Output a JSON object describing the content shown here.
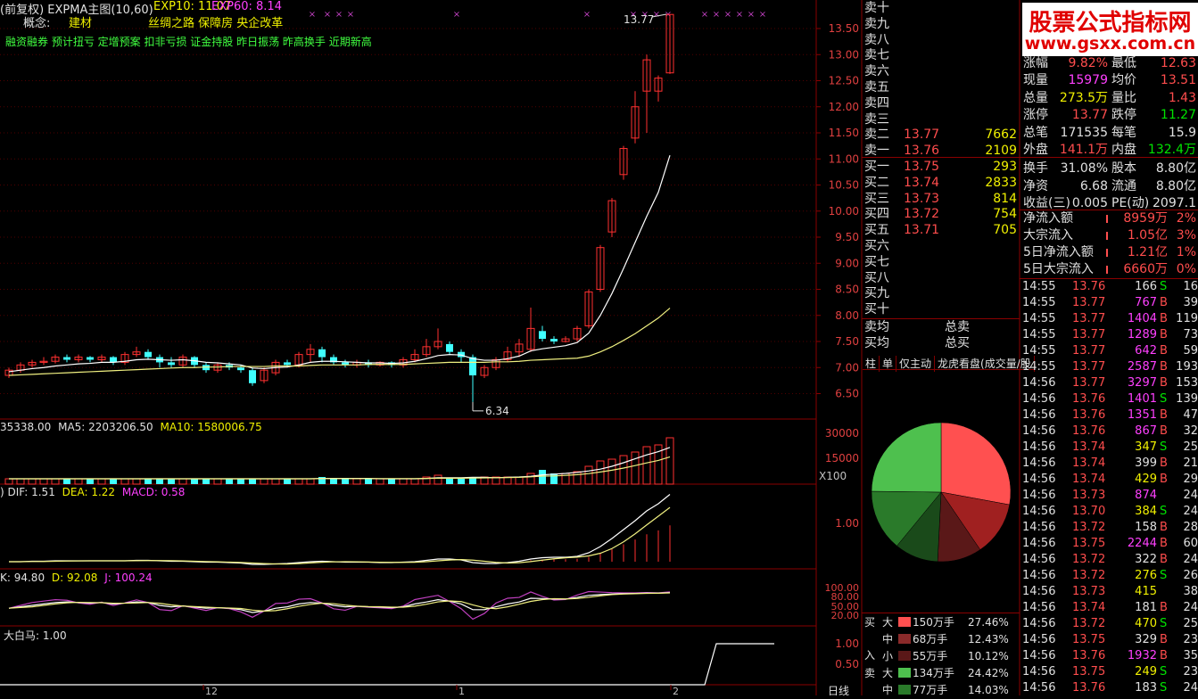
{
  "header": {
    "title": "(前复权) EXPMA主图(10,60)",
    "exp10": "EXP10: 11.07",
    "exp60": "EXP60: 8.14",
    "concept_label": "概念:",
    "concept_value": "建材",
    "concept_tags": "丝绸之路 保障房 央企改革",
    "tags_line": "融资融券 预计扭亏 定增预案 扣非亏损 证金持股 昨日振荡 昨高换手 近期新高"
  },
  "price_axis": [
    "13.50",
    "13.00",
    "12.50",
    "12.00",
    "11.50",
    "11.00",
    "10.50",
    "10.00",
    "9.50",
    "9.00",
    "8.50",
    "8.00",
    "7.50",
    "7.00",
    "6.50"
  ],
  "annotations": {
    "high": "13.77",
    "low": "6.34"
  },
  "volume": {
    "label_vol": "35338.00",
    "label_ma5": "MA5: 2203206.50",
    "label_ma10": "MA10: 1580006.75",
    "axis": [
      "30000",
      "15000",
      "X100"
    ]
  },
  "macd": {
    "dif": "DIF: 1.51",
    "dea": "DEA: 1.22",
    "macd": "MACD: 0.58",
    "axis": [
      "1.00"
    ]
  },
  "kdj": {
    "k": "K: 94.80",
    "d": "D: 92.08",
    "j": "J: 100.24",
    "axis": [
      "100.00",
      "80.00",
      "50.00",
      "20.00"
    ]
  },
  "dbm": {
    "label": "大白马: 1.00",
    "axis": [
      "1.00",
      "0.50"
    ]
  },
  "time_axis": {
    "labels": [
      "12",
      "1",
      "2"
    ],
    "period": "日线"
  },
  "logo": {
    "title": "股票公式指标网",
    "url": "www.gsxx.com.cn"
  },
  "order_book": {
    "sells": [
      {
        "label": "卖十",
        "price": "",
        "vol": ""
      },
      {
        "label": "卖九",
        "price": "",
        "vol": ""
      },
      {
        "label": "卖八",
        "price": "",
        "vol": ""
      },
      {
        "label": "卖七",
        "price": "",
        "vol": ""
      },
      {
        "label": "卖六",
        "price": "",
        "vol": ""
      },
      {
        "label": "卖五",
        "price": "",
        "vol": ""
      },
      {
        "label": "卖四",
        "price": "",
        "vol": ""
      },
      {
        "label": "卖三",
        "price": "",
        "vol": ""
      },
      {
        "label": "卖二",
        "price": "13.77",
        "vol": "7662"
      },
      {
        "label": "卖一",
        "price": "13.76",
        "vol": "2109"
      }
    ],
    "buys": [
      {
        "label": "买一",
        "price": "13.75",
        "vol": "293"
      },
      {
        "label": "买二",
        "price": "13.74",
        "vol": "2833"
      },
      {
        "label": "买三",
        "price": "13.73",
        "vol": "814"
      },
      {
        "label": "买四",
        "price": "13.72",
        "vol": "754"
      },
      {
        "label": "买五",
        "price": "13.71",
        "vol": "705"
      },
      {
        "label": "买六",
        "price": "",
        "vol": ""
      },
      {
        "label": "买七",
        "price": "",
        "vol": ""
      },
      {
        "label": "买八",
        "price": "",
        "vol": ""
      },
      {
        "label": "买九",
        "price": "",
        "vol": ""
      },
      {
        "label": "买十",
        "price": "",
        "vol": ""
      }
    ],
    "avg_sell": "卖均",
    "total_sell": "总卖",
    "avg_buy": "买均",
    "total_buy": "总买"
  },
  "quote": {
    "rows": [
      [
        {
          "l": "涨幅",
          "v": "9.82%",
          "c": "red"
        },
        {
          "l": "最低",
          "v": "12.63",
          "c": "red"
        }
      ],
      [
        {
          "l": "现量",
          "v": "15979",
          "c": "mag"
        },
        {
          "l": "均价",
          "v": "13.51",
          "c": "red"
        }
      ],
      [
        {
          "l": "总量",
          "v": "273.5万",
          "c": "yel"
        },
        {
          "l": "量比",
          "v": "1.43",
          "c": "red"
        }
      ],
      [
        {
          "l": "涨停",
          "v": "13.77",
          "c": "red"
        },
        {
          "l": "跌停",
          "v": "11.27",
          "c": "grn"
        }
      ],
      [
        {
          "l": "总笔",
          "v": "171535",
          "c": "wht"
        },
        {
          "l": "每笔",
          "v": "15.9",
          "c": "wht"
        }
      ],
      [
        {
          "l": "外盘",
          "v": "141.1万",
          "c": "red"
        },
        {
          "l": "内盘",
          "v": "132.4万",
          "c": "grn"
        }
      ],
      [
        {
          "l": "换手",
          "v": "31.08%",
          "c": "wht"
        },
        {
          "l": "股本",
          "v": "8.80亿",
          "c": "wht"
        }
      ],
      [
        {
          "l": "净资",
          "v": "6.68",
          "c": "wht"
        },
        {
          "l": "流通",
          "v": "8.80亿",
          "c": "wht"
        }
      ],
      [
        {
          "l": "收益(三)",
          "v": "0.005",
          "c": "wht"
        },
        {
          "l": "PE(动)",
          "v": "2097.1",
          "c": "wht"
        }
      ]
    ],
    "flows": [
      {
        "l": "净流入额",
        "v": "8959万",
        "p": "2%"
      },
      {
        "l": "大宗流入",
        "v": "1.05亿",
        "p": "3%"
      },
      {
        "l": "5日净流入额",
        "v": "1.21亿",
        "p": "1%"
      },
      {
        "l": "5日大宗流入",
        "v": "6660万",
        "p": "0%"
      }
    ]
  },
  "tabs": [
    "柱",
    "单",
    "仅主动",
    "龙虎看盘(成交量/股"
  ],
  "pie": {
    "slices": [
      {
        "name": "买大",
        "pct": 27.46,
        "color": "#ff5050"
      },
      {
        "name": "买中",
        "pct": 12.43,
        "color": "#a02020"
      },
      {
        "name": "买小",
        "pct": 10.12,
        "color": "#5a1818"
      },
      {
        "name": "卖小",
        "pct": 10.0,
        "color": "#1a4a1a"
      },
      {
        "name": "卖中",
        "pct": 14.03,
        "color": "#2a7a2a"
      },
      {
        "name": "卖大",
        "pct": 24.42,
        "color": "#4ec04e"
      }
    ]
  },
  "flow_table": {
    "side_buy": "买",
    "side_in": "入",
    "side_sell": "卖",
    "rows": [
      {
        "size": "大",
        "amt": "150万手",
        "pct": "27.46%",
        "color": "#ff5050"
      },
      {
        "size": "中",
        "amt": "68万手",
        "pct": "12.43%",
        "color": "#8a2a2a"
      },
      {
        "size": "小",
        "amt": "55万手",
        "pct": "10.12%",
        "color": "#5a1818"
      },
      {
        "size": "大",
        "amt": "134万手",
        "pct": "24.42%",
        "color": "#4ec04e"
      },
      {
        "size": "中",
        "amt": "77万手",
        "pct": "14.03%",
        "color": "#2a7a2a"
      }
    ]
  },
  "ticks": [
    {
      "t": "14:55",
      "p": "13.76",
      "v": "166",
      "s": "S",
      "n": "16",
      "vc": "wht"
    },
    {
      "t": "14:55",
      "p": "13.77",
      "v": "767",
      "s": "B",
      "n": "39",
      "vc": "mag"
    },
    {
      "t": "14:55",
      "p": "13.77",
      "v": "1404",
      "s": "B",
      "n": "119",
      "vc": "mag"
    },
    {
      "t": "14:55",
      "p": "13.77",
      "v": "1289",
      "s": "B",
      "n": "73",
      "vc": "mag"
    },
    {
      "t": "14:55",
      "p": "13.77",
      "v": "642",
      "s": "B",
      "n": "59",
      "vc": "mag"
    },
    {
      "t": "14:55",
      "p": "13.77",
      "v": "2587",
      "s": "B",
      "n": "193",
      "vc": "mag"
    },
    {
      "t": "14:56",
      "p": "13.77",
      "v": "3297",
      "s": "B",
      "n": "153",
      "vc": "mag"
    },
    {
      "t": "14:56",
      "p": "13.76",
      "v": "1401",
      "s": "S",
      "n": "139",
      "vc": "mag"
    },
    {
      "t": "14:56",
      "p": "13.76",
      "v": "1351",
      "s": "B",
      "n": "47",
      "vc": "mag"
    },
    {
      "t": "14:56",
      "p": "13.76",
      "v": "867",
      "s": "B",
      "n": "32",
      "vc": "mag"
    },
    {
      "t": "14:56",
      "p": "13.74",
      "v": "347",
      "s": "S",
      "n": "25",
      "vc": "yel"
    },
    {
      "t": "14:56",
      "p": "13.74",
      "v": "399",
      "s": "B",
      "n": "21",
      "vc": "wht"
    },
    {
      "t": "14:56",
      "p": "13.74",
      "v": "429",
      "s": "B",
      "n": "29",
      "vc": "yel"
    },
    {
      "t": "14:56",
      "p": "13.73",
      "v": "874",
      "s": "",
      "n": "24",
      "vc": "mag"
    },
    {
      "t": "14:56",
      "p": "13.70",
      "v": "384",
      "s": "S",
      "n": "24",
      "vc": "yel"
    },
    {
      "t": "14:56",
      "p": "13.72",
      "v": "158",
      "s": "B",
      "n": "28",
      "vc": "wht"
    },
    {
      "t": "14:56",
      "p": "13.75",
      "v": "2244",
      "s": "B",
      "n": "60",
      "vc": "mag"
    },
    {
      "t": "14:56",
      "p": "13.72",
      "v": "322",
      "s": "B",
      "n": "24",
      "vc": "wht"
    },
    {
      "t": "14:56",
      "p": "13.72",
      "v": "276",
      "s": "S",
      "n": "26",
      "vc": "yel"
    },
    {
      "t": "14:56",
      "p": "13.73",
      "v": "415",
      "s": "",
      "n": "38",
      "vc": "yel"
    },
    {
      "t": "14:56",
      "p": "13.74",
      "v": "181",
      "s": "B",
      "n": "24",
      "vc": "wht"
    },
    {
      "t": "14:56",
      "p": "13.72",
      "v": "470",
      "s": "S",
      "n": "25",
      "vc": "yel"
    },
    {
      "t": "14:56",
      "p": "13.75",
      "v": "329",
      "s": "B",
      "n": "23",
      "vc": "wht"
    },
    {
      "t": "14:56",
      "p": "13.76",
      "v": "1932",
      "s": "B",
      "n": "35",
      "vc": "mag"
    },
    {
      "t": "14:56",
      "p": "13.75",
      "v": "249",
      "s": "S",
      "n": "23",
      "vc": "yel"
    },
    {
      "t": "14:56",
      "p": "13.76",
      "v": "183",
      "s": "S",
      "n": "24",
      "vc": "wht"
    }
  ],
  "candles": [
    [
      6.85,
      6.95,
      6.8,
      7.0
    ],
    [
      6.95,
      7.05,
      6.9,
      7.1
    ],
    [
      7.05,
      7.1,
      7.0,
      7.15
    ],
    [
      7.1,
      7.12,
      7.05,
      7.2
    ],
    [
      7.12,
      7.2,
      7.08,
      7.25
    ],
    [
      7.2,
      7.15,
      7.1,
      7.25
    ],
    [
      7.15,
      7.2,
      7.1,
      7.25
    ],
    [
      7.2,
      7.15,
      7.1,
      7.22
    ],
    [
      7.15,
      7.2,
      7.1,
      7.25
    ],
    [
      7.2,
      7.1,
      7.05,
      7.22
    ],
    [
      7.1,
      7.25,
      7.05,
      7.3
    ],
    [
      7.25,
      7.3,
      7.2,
      7.4
    ],
    [
      7.3,
      7.2,
      7.15,
      7.35
    ],
    [
      7.2,
      7.1,
      7.0,
      7.25
    ],
    [
      7.1,
      7.05,
      7.0,
      7.2
    ],
    [
      7.05,
      7.2,
      7.0,
      7.25
    ],
    [
      7.2,
      7.05,
      7.0,
      7.22
    ],
    [
      7.05,
      6.95,
      6.9,
      7.1
    ],
    [
      6.95,
      7.05,
      6.9,
      7.1
    ],
    [
      7.05,
      7.0,
      6.95,
      7.1
    ],
    [
      7.0,
      6.95,
      6.9,
      7.05
    ],
    [
      6.95,
      6.7,
      6.65,
      7.0
    ],
    [
      6.75,
      6.95,
      6.7,
      7.0
    ],
    [
      6.9,
      7.1,
      6.85,
      7.15
    ],
    [
      7.1,
      7.05,
      7.0,
      7.15
    ],
    [
      7.05,
      7.25,
      7.0,
      7.3
    ],
    [
      7.25,
      7.35,
      7.1,
      7.45
    ],
    [
      7.35,
      7.2,
      7.1,
      7.4
    ],
    [
      7.2,
      7.1,
      7.05,
      7.25
    ],
    [
      7.1,
      7.05,
      7.0,
      7.15
    ],
    [
      7.05,
      7.1,
      7.0,
      7.15
    ],
    [
      7.1,
      7.05,
      7.0,
      7.15
    ],
    [
      7.05,
      7.1,
      7.02,
      7.12
    ],
    [
      7.1,
      7.05,
      7.0,
      7.12
    ],
    [
      7.05,
      7.15,
      7.0,
      7.2
    ],
    [
      7.15,
      7.25,
      7.1,
      7.35
    ],
    [
      7.25,
      7.4,
      7.2,
      7.55
    ],
    [
      7.4,
      7.5,
      7.35,
      7.75
    ],
    [
      7.45,
      7.3,
      7.25,
      7.5
    ],
    [
      7.3,
      7.2,
      7.1,
      7.35
    ],
    [
      7.2,
      6.85,
      6.34,
      7.25
    ],
    [
      6.85,
      7.0,
      6.8,
      7.05
    ],
    [
      7.0,
      7.15,
      6.95,
      7.2
    ],
    [
      7.15,
      7.3,
      7.1,
      7.4
    ],
    [
      7.3,
      7.45,
      7.2,
      7.55
    ],
    [
      7.35,
      7.75,
      7.3,
      8.15
    ],
    [
      7.7,
      7.55,
      7.5,
      7.8
    ],
    [
      7.55,
      7.5,
      7.45,
      7.6
    ],
    [
      7.5,
      7.55,
      7.48,
      7.6
    ],
    [
      7.55,
      7.75,
      7.5,
      7.8
    ],
    [
      7.8,
      8.45,
      7.75,
      8.5
    ],
    [
      8.5,
      9.3,
      8.45,
      9.35
    ],
    [
      9.6,
      10.2,
      9.5,
      10.25
    ],
    [
      10.7,
      11.2,
      10.6,
      11.25
    ],
    [
      11.4,
      12.0,
      11.3,
      12.3
    ],
    [
      12.3,
      12.9,
      11.5,
      13.0
    ],
    [
      12.3,
      12.55,
      12.1,
      12.6
    ],
    [
      12.65,
      13.77,
      12.63,
      13.77
    ]
  ],
  "exp10": [
    6.92,
    6.95,
    6.98,
    7.0,
    7.03,
    7.05,
    7.07,
    7.08,
    7.1,
    7.1,
    7.12,
    7.15,
    7.16,
    7.15,
    7.14,
    7.15,
    7.13,
    7.1,
    7.09,
    7.07,
    7.05,
    6.99,
    6.98,
    7.0,
    7.01,
    7.05,
    7.1,
    7.12,
    7.12,
    7.11,
    7.1,
    7.09,
    7.09,
    7.08,
    7.09,
    7.12,
    7.17,
    7.23,
    7.25,
    7.24,
    7.17,
    7.14,
    7.14,
    7.17,
    7.22,
    7.32,
    7.36,
    7.39,
    7.42,
    7.48,
    7.66,
    8.0,
    8.42,
    8.9,
    9.4,
    9.9,
    10.36,
    11.07
  ],
  "exp60": [
    6.85,
    6.86,
    6.87,
    6.88,
    6.89,
    6.9,
    6.91,
    6.92,
    6.93,
    6.94,
    6.95,
    6.96,
    6.97,
    6.98,
    6.99,
    7.0,
    7.0,
    7.01,
    7.01,
    7.02,
    7.02,
    7.02,
    7.02,
    7.03,
    7.03,
    7.03,
    7.04,
    7.05,
    7.05,
    7.05,
    7.05,
    7.06,
    7.06,
    7.06,
    7.06,
    7.07,
    7.08,
    7.09,
    7.1,
    7.1,
    7.1,
    7.1,
    7.11,
    7.11,
    7.12,
    7.14,
    7.15,
    7.16,
    7.17,
    7.18,
    7.22,
    7.3,
    7.4,
    7.52,
    7.65,
    7.8,
    7.95,
    8.14
  ],
  "vol": [
    3,
    3,
    3,
    3,
    3,
    3,
    3,
    3,
    3,
    3,
    3,
    3,
    3,
    3,
    3,
    3,
    3,
    3,
    3,
    3,
    3,
    3,
    3,
    3,
    3,
    3,
    3,
    4,
    3,
    3,
    3,
    3,
    3,
    3,
    3,
    3,
    4,
    5,
    3,
    3,
    4,
    4,
    4,
    4,
    4,
    6,
    8,
    6,
    6,
    7,
    10,
    13,
    14,
    16,
    18,
    21,
    22,
    26
  ],
  "macd_dif": [
    0,
    0,
    0.01,
    0.01,
    0.02,
    0.02,
    0.02,
    0.02,
    0.02,
    0.02,
    0.02,
    0.03,
    0.03,
    0.02,
    0.01,
    0.01,
    0.0,
    -0.01,
    -0.01,
    -0.02,
    -0.03,
    -0.06,
    -0.06,
    -0.05,
    -0.04,
    -0.02,
    0,
    0.01,
    0.0,
    -0.01,
    -0.01,
    -0.01,
    -0.02,
    -0.02,
    -0.01,
    0,
    0.03,
    0.06,
    0.06,
    0.04,
    -0.02,
    -0.04,
    -0.04,
    -0.02,
    0.01,
    0.06,
    0.09,
    0.1,
    0.1,
    0.12,
    0.2,
    0.34,
    0.52,
    0.72,
    0.92,
    1.14,
    1.3,
    1.51
  ],
  "kdj_k": [
    40,
    45,
    50,
    55,
    60,
    62,
    60,
    58,
    60,
    55,
    58,
    62,
    60,
    50,
    45,
    48,
    44,
    40,
    42,
    40,
    35,
    25,
    30,
    40,
    45,
    55,
    60,
    58,
    50,
    45,
    47,
    45,
    44,
    42,
    45,
    55,
    62,
    70,
    65,
    55,
    35,
    35,
    45,
    55,
    62,
    75,
    74,
    72,
    72,
    78,
    85,
    88,
    90,
    91,
    92,
    93,
    93,
    94.8
  ]
}
